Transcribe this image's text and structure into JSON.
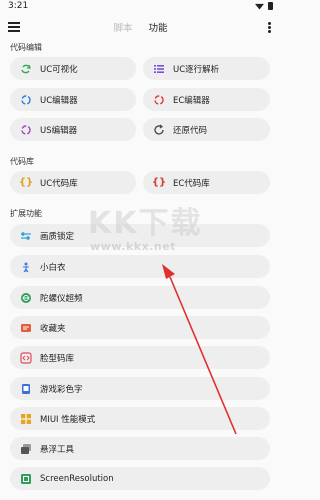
{
  "status_bar": {
    "time": "3:21"
  },
  "app_bar": {
    "tabs": [
      {
        "label": "脚本"
      },
      {
        "label": "功能"
      }
    ]
  },
  "sections": {
    "code_edit": {
      "title": "代码编辑",
      "items": [
        {
          "label": "UC可视化",
          "icon": "recycle-icon",
          "color": "#35a853"
        },
        {
          "label": "UC逐行解析",
          "icon": "list-icon",
          "color": "#7a4fd6"
        },
        {
          "label": "UC编辑器",
          "icon": "cycle-icon",
          "color": "#2f7de0"
        },
        {
          "label": "EC编辑器",
          "icon": "cycle-icon",
          "color": "#e23a3a"
        },
        {
          "label": "US编辑器",
          "icon": "cycle-icon",
          "color": "#a347c7"
        },
        {
          "label": "还原代码",
          "icon": "refresh-icon",
          "color": "#444444"
        }
      ]
    },
    "code_lib": {
      "title": "代码库",
      "items": [
        {
          "label": "UC代码库",
          "icon": "braces-icon",
          "color": "#e0a020"
        },
        {
          "label": "EC代码库",
          "icon": "braces-icon",
          "color": "#d03a3a"
        }
      ]
    },
    "extensions": {
      "title": "扩展功能",
      "items": [
        {
          "label": "画质锁定",
          "icon": "sliders-icon",
          "color": "#2aa0d8"
        },
        {
          "label": "小白衣",
          "icon": "person-icon",
          "color": "#3a7de0"
        },
        {
          "label": "陀螺仪超频",
          "icon": "gyro-icon",
          "color": "#2e9e5a"
        },
        {
          "label": "收藏夹",
          "icon": "folder-icon",
          "color": "#e25b3a"
        },
        {
          "label": "脸型码库",
          "icon": "code-icon",
          "color": "#e24a5a"
        },
        {
          "label": "游戏彩色字",
          "icon": "doc-icon",
          "color": "#3d6fd8"
        },
        {
          "label": "MIUI 性能模式",
          "icon": "grid-icon",
          "color": "#e5a51f"
        },
        {
          "label": "悬浮工具",
          "icon": "stack-icon",
          "color": "#555555"
        },
        {
          "label": "ScreenResolution",
          "icon": "screen-icon",
          "color": "#2e9e5a"
        }
      ]
    }
  },
  "watermark": {
    "brand": "KK下载",
    "url": "www.kkx.net"
  },
  "accent_arrow_color": "#e03030"
}
